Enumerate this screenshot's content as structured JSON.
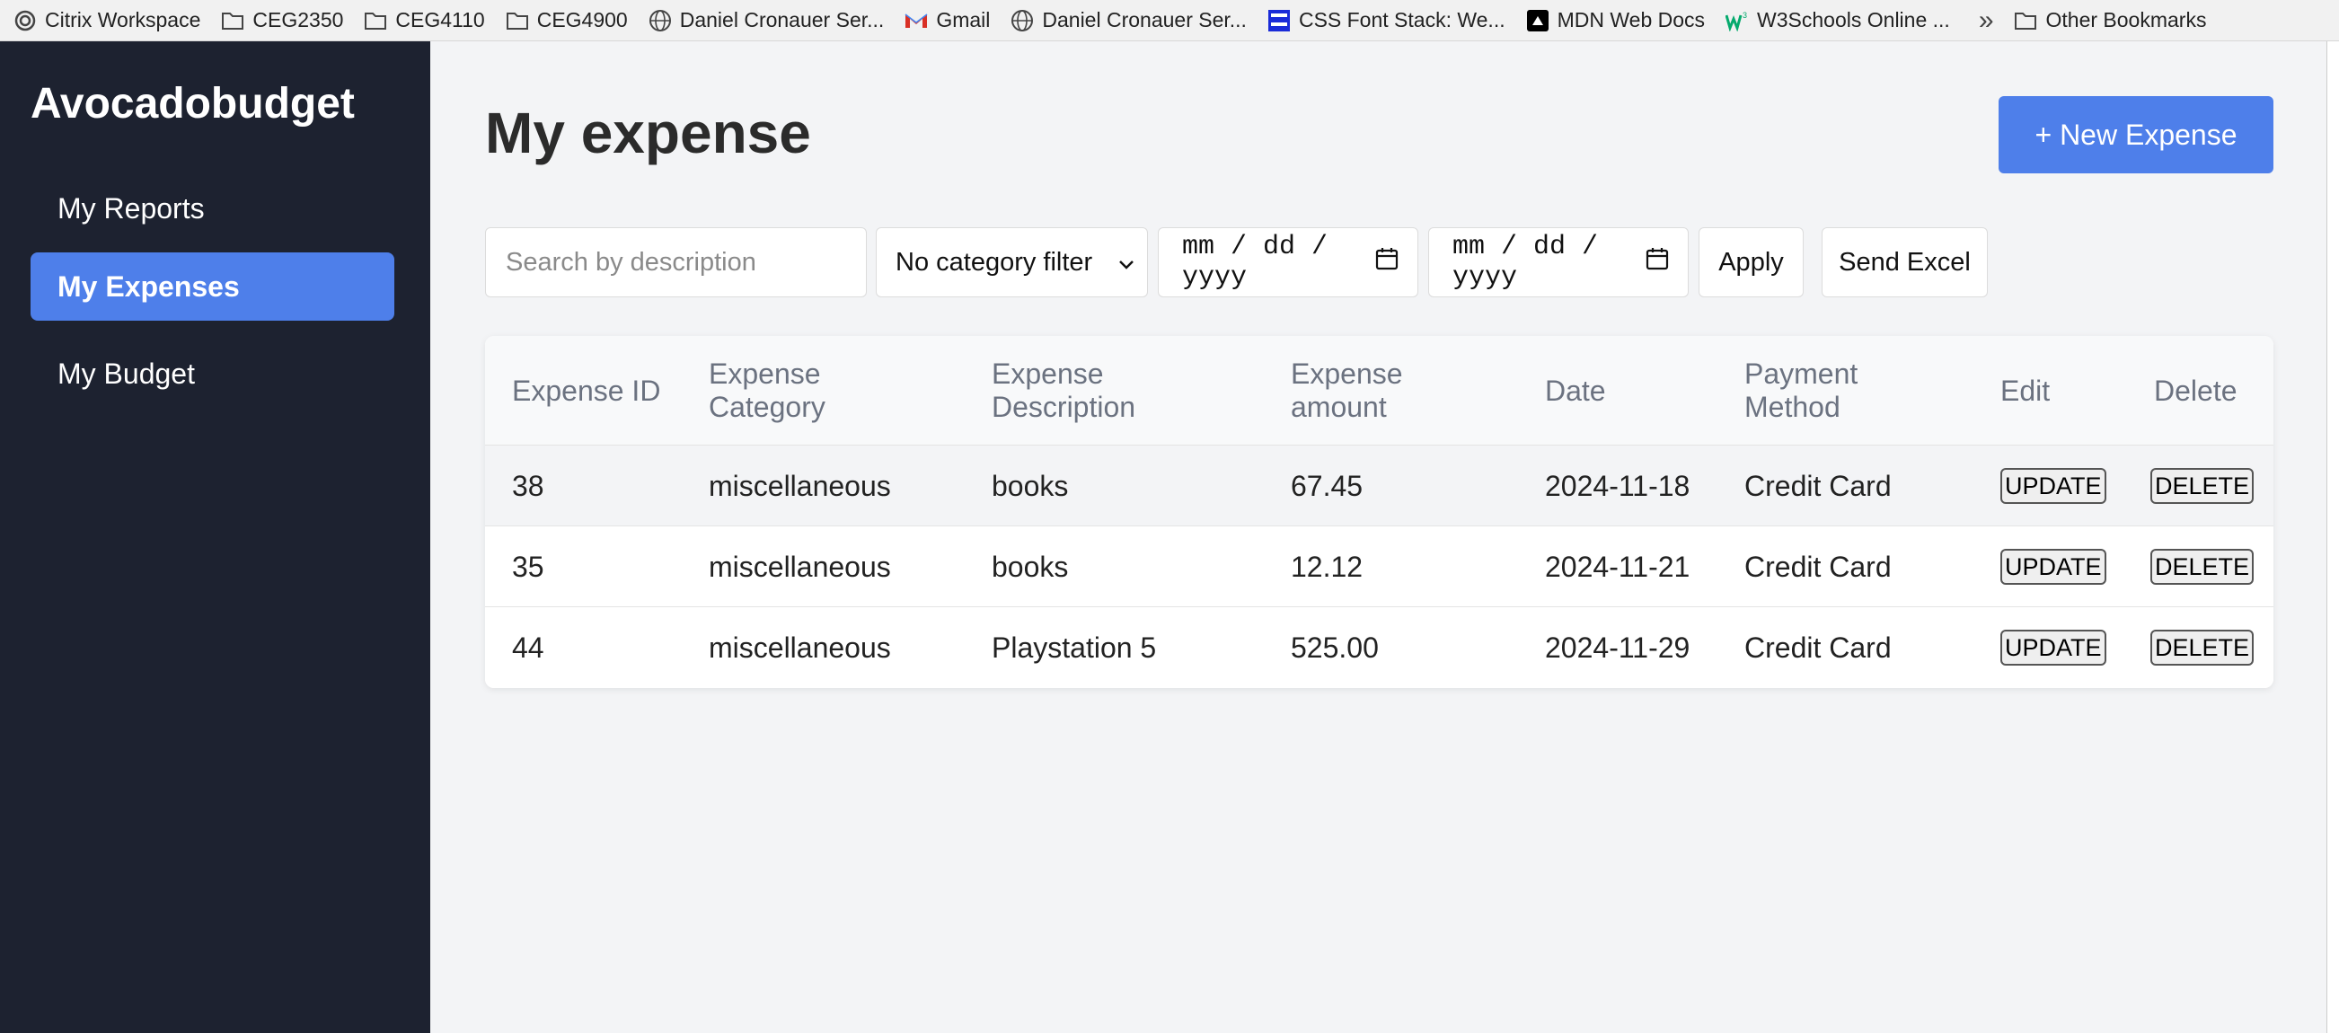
{
  "bookmarks": {
    "items": [
      {
        "label": "Citrix Workspace",
        "icon": "citrix-icon"
      },
      {
        "label": "CEG2350",
        "icon": "folder-icon"
      },
      {
        "label": "CEG4110",
        "icon": "folder-icon"
      },
      {
        "label": "CEG4900",
        "icon": "folder-icon"
      },
      {
        "label": "Daniel Cronauer Ser...",
        "icon": "globe-icon"
      },
      {
        "label": "Gmail",
        "icon": "gmail-icon"
      },
      {
        "label": "Daniel Cronauer Ser...",
        "icon": "globe-icon"
      },
      {
        "label": "CSS Font Stack: We...",
        "icon": "cssfontstack-icon"
      },
      {
        "label": "MDN Web Docs",
        "icon": "mdn-icon"
      },
      {
        "label": "W3Schools Online ...",
        "icon": "w3schools-icon"
      }
    ],
    "more": "»",
    "other": "Other Bookmarks"
  },
  "sidebar": {
    "brand": "Avocadobudget",
    "items": [
      {
        "label": "My Reports",
        "active": false
      },
      {
        "label": "My Expenses",
        "active": true
      },
      {
        "label": "My Budget",
        "active": false
      }
    ]
  },
  "main": {
    "title": "My expense",
    "new_button": "+ New Expense",
    "filters": {
      "search_placeholder": "Search by description",
      "category": "No category filter",
      "date_from": "mm / dd / yyyy",
      "date_to": "mm / dd / yyyy",
      "apply": "Apply",
      "send_excel": "Send Excel"
    },
    "table": {
      "headers": [
        "Expense ID",
        "Expense Category",
        "Expense Description",
        "Expense amount",
        "Date",
        "Payment Method",
        "Edit",
        "Delete"
      ],
      "rows": [
        {
          "id": "38",
          "category": "miscellaneous",
          "description": "books",
          "amount": "67.45",
          "date": "2024-11-18",
          "method": "Credit Card",
          "edit": "UPDATE",
          "delete": "DELETE"
        },
        {
          "id": "35",
          "category": "miscellaneous",
          "description": "books",
          "amount": "12.12",
          "date": "2024-11-21",
          "method": "Credit Card",
          "edit": "UPDATE",
          "delete": "DELETE"
        },
        {
          "id": "44",
          "category": "miscellaneous",
          "description": "Playstation 5",
          "amount": "525.00",
          "date": "2024-11-29",
          "method": "Credit Card",
          "edit": "UPDATE",
          "delete": "DELETE"
        }
      ]
    }
  },
  "colors": {
    "accent": "#4e7fea",
    "sidebar_bg": "#1d2230",
    "page_bg": "#f3f4f6"
  }
}
